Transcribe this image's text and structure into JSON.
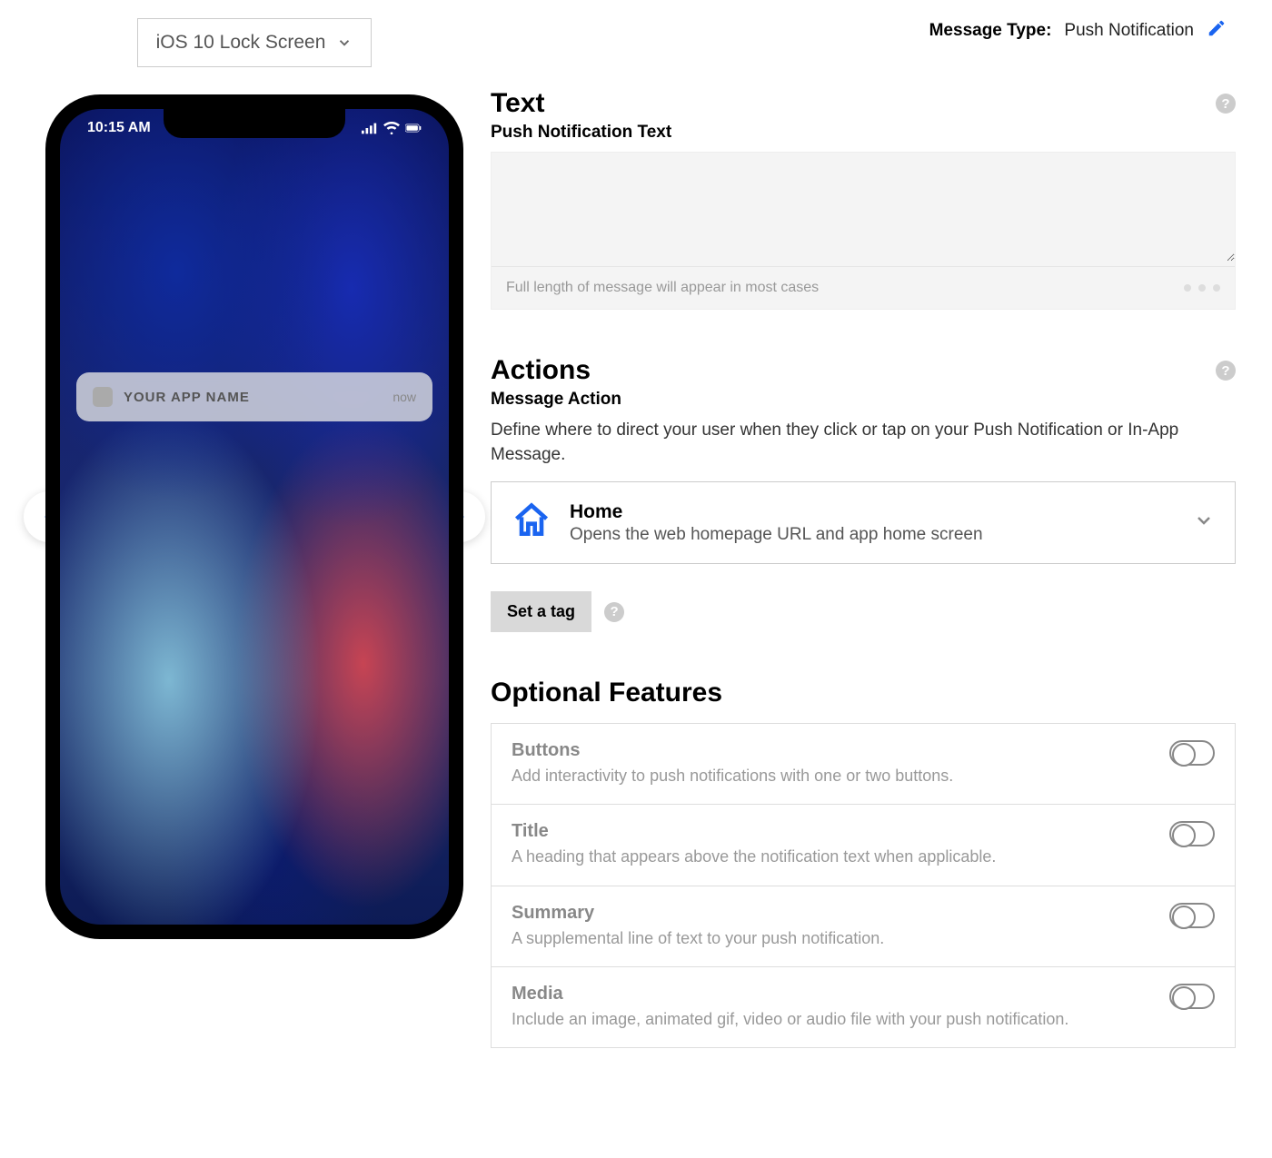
{
  "device_selector": {
    "label": "iOS 10 Lock Screen"
  },
  "phone": {
    "time": "10:15 AM",
    "notification": {
      "app_name": "YOUR APP NAME",
      "time_label": "now"
    }
  },
  "header": {
    "message_type_label": "Message Type:",
    "message_type_value": "Push Notification"
  },
  "text_section": {
    "title": "Text",
    "subtitle": "Push Notification Text",
    "footer_hint": "Full length of message will appear in most cases"
  },
  "actions_section": {
    "title": "Actions",
    "subtitle": "Message Action",
    "description": "Define where to direct your user when they click or tap on your Push Notification or In-App Message.",
    "selected": {
      "title": "Home",
      "subtitle": "Opens the web homepage URL and app home screen"
    },
    "set_tag_label": "Set a tag"
  },
  "optional_section": {
    "title": "Optional Features",
    "items": [
      {
        "title": "Buttons",
        "desc": "Add interactivity to push notifications with one or two buttons."
      },
      {
        "title": "Title",
        "desc": "A heading that appears above the notification text when applicable."
      },
      {
        "title": "Summary",
        "desc": "A supplemental line of text to your push notification."
      },
      {
        "title": "Media",
        "desc": "Include an image, animated gif, video or audio file with your push notification."
      }
    ]
  }
}
